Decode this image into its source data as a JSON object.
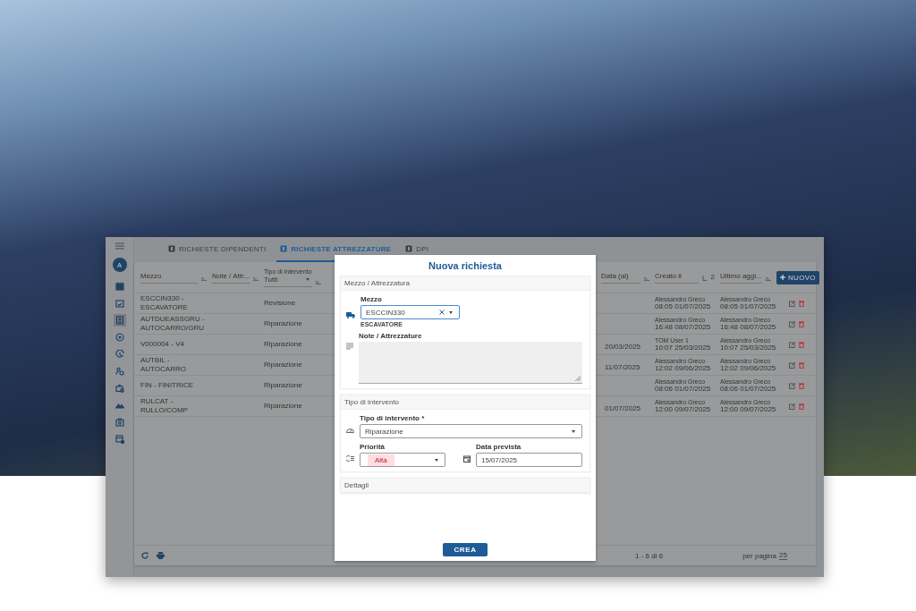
{
  "sidebar": {
    "avatar": "A",
    "items": [
      {
        "kind": "calendar",
        "selected": false
      },
      {
        "kind": "calendar-check",
        "selected": false
      },
      {
        "kind": "id-card",
        "selected": true
      },
      {
        "kind": "target",
        "selected": false
      },
      {
        "kind": "clock",
        "selected": false
      },
      {
        "kind": "people",
        "selected": false
      },
      {
        "kind": "briefcase",
        "selected": false
      },
      {
        "kind": "hills",
        "selected": false
      },
      {
        "kind": "camera",
        "selected": false
      },
      {
        "kind": "list",
        "selected": false
      }
    ]
  },
  "tabs": [
    {
      "label": "RICHIESTE DIPENDENTI",
      "selected": false
    },
    {
      "label": "RICHIESTE ATTREZZATURE",
      "selected": true
    },
    {
      "label": "DPI",
      "selected": false
    }
  ],
  "filters": [
    {
      "kind": "text",
      "label": "Mezzo"
    },
    {
      "kind": "text",
      "label": "Note / Attr..."
    },
    {
      "kind": "select",
      "caption": "Tipo di intervento",
      "value": "Tutti"
    },
    {
      "kind": "hidden"
    },
    {
      "kind": "text",
      "label": "Data (al)"
    },
    {
      "kind": "sort",
      "label": "Creato il",
      "sort_order": "2"
    },
    {
      "kind": "text",
      "label": "Ultimo aggi..."
    }
  ],
  "new_button": "NUOVO",
  "rows": [
    {
      "mezzo": "ESCCIN330 - ESCAVATORE",
      "tipo": "Revisione",
      "created_by": "Alessandro Greco",
      "created_at": "08:05 01/07/2025",
      "updated_by": "Alessandro Greco",
      "updated_at": "08:05 01/07/2025"
    },
    {
      "mezzo": "AUTDUEASSGRU - AUTOCARRO/GRU",
      "tipo": "Riparazione",
      "created_by": "Alessandro Greco",
      "created_at": "16:48 08/07/2025",
      "updated_by": "Alessandro Greco",
      "updated_at": "16:48 08/07/2025"
    },
    {
      "mezzo": "V000004 - V4",
      "tipo": "Riparazione",
      "data": "20/03/2025",
      "created_by": "TOM User 1",
      "created_at": "10:07 25/03/2025",
      "updated_by": "Alessandro Greco",
      "updated_at": "10:07 25/03/2025"
    },
    {
      "mezzo": "AUTBIL - AUTOCARRO",
      "tipo": "Riparazione",
      "data": "11/07/2025",
      "created_by": "Alessandro Greco",
      "created_at": "12:02 09/06/2025",
      "updated_by": "Alessandro Greco",
      "updated_at": "12:02 09/06/2025"
    },
    {
      "mezzo": "FIN - FINITRICE",
      "tipo": "Riparazione",
      "created_by": "Alessandro Greco",
      "created_at": "08:06 01/07/2025",
      "updated_by": "Alessandro Greco",
      "updated_at": "08:06 01/07/2025"
    },
    {
      "mezzo": "RULCAT - RULLO/COMP",
      "tipo": "Riparazione",
      "data": "01/07/2025",
      "created_by": "Alessandro Greco",
      "created_at": "12:00 09/07/2025",
      "updated_by": "Alessandro Greco",
      "updated_at": "12:00 09/07/2025"
    }
  ],
  "footer": {
    "range": "1 - 6 di 6",
    "per_page_label": "per pagina",
    "per_page": "25"
  },
  "modal": {
    "title": "Nuova richiesta",
    "section_1": {
      "header": "Mezzo / Attrezzatura",
      "mezzo_label": "Mezzo",
      "mezzo_value": "ESCCIN330",
      "mezzo_helper": "ESCAVATORE",
      "note_label": "Note / Attrezzature"
    },
    "section_2": {
      "header": "Tipo di intervento",
      "tipo_label": "Tipo di intervento *",
      "tipo_value": "Riparazione",
      "priorita_label": "Priorità",
      "priorita_value": "Alta",
      "data_label": "Data prevista",
      "data_value": "15/07/2025"
    },
    "section_3": {
      "header": "Dettagli"
    },
    "submit": "CREA"
  }
}
